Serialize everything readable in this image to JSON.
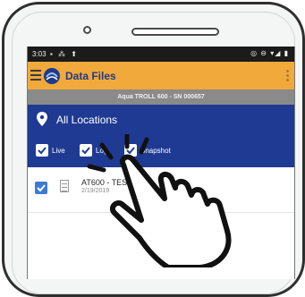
{
  "status_bar": {
    "time": "3:03"
  },
  "app_bar": {
    "title": "Data Files"
  },
  "sub_bar": {
    "device": "Aqua TROLL 600 - SN 000657"
  },
  "filters": {
    "location": "All Locations",
    "checkboxes": [
      {
        "label": "Live",
        "checked": true
      },
      {
        "label": "Log",
        "checked": true
      },
      {
        "label": "Snapshot",
        "checked": true
      }
    ]
  },
  "files": [
    {
      "name": "AT600 - TEST",
      "date": "2/19/2019",
      "checked": true
    }
  ],
  "colors": {
    "accent": "#f2a93b",
    "panel": "#1f3a93",
    "checkbox": "#3a7bd5"
  }
}
